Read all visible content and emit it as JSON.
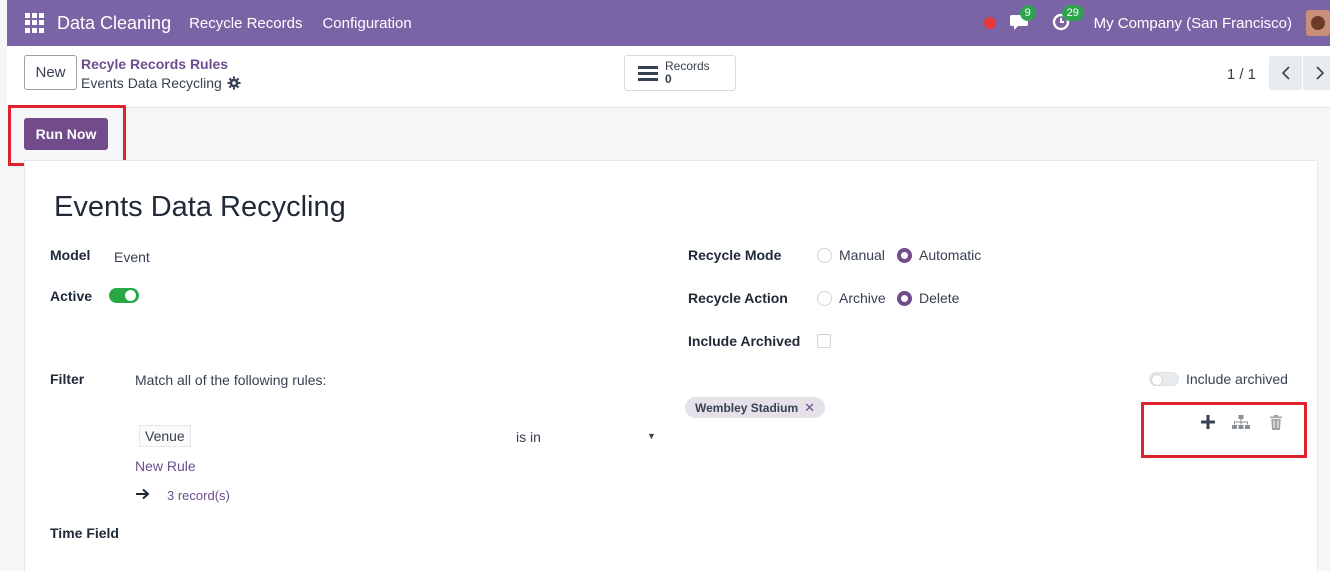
{
  "navbar": {
    "app_title": "Data Cleaning",
    "menu": [
      "Recycle Records",
      "Configuration"
    ],
    "messages_badge": "9",
    "activity_badge": "29",
    "company": "My Company (San Francisco)"
  },
  "control": {
    "new_label": "New",
    "breadcrumb_parent": "Recyle Records Rules",
    "breadcrumb_current": "Events Data Recycling",
    "stat_label": "Records",
    "stat_value": "0",
    "pager": "1 / 1"
  },
  "status": {
    "run_now_label": "Run Now"
  },
  "form": {
    "title": "Events Data Recycling",
    "model_label": "Model",
    "model_value": "Event",
    "active_label": "Active",
    "active": true,
    "recycle_mode_label": "Recycle Mode",
    "recycle_mode_options": [
      "Manual",
      "Automatic"
    ],
    "recycle_mode_selected": "Automatic",
    "recycle_action_label": "Recycle Action",
    "recycle_action_options": [
      "Archive",
      "Delete"
    ],
    "recycle_action_selected": "Delete",
    "include_archived_label": "Include Archived",
    "include_archived": false,
    "filter_label": "Filter",
    "filter_match_text": "Match all of the following rules:",
    "filter_include_archived_label": "Include archived",
    "rule_field": "Venue",
    "rule_operator": "is in",
    "rule_value_tag": "Wembley Stadium",
    "new_rule_label": "New Rule",
    "records_link": "3 record(s)",
    "time_field_label": "Time Field"
  },
  "colors": {
    "navbar": "#7a64a5",
    "primary": "#714b8a",
    "highlight": "#e0212e",
    "toggle_on": "#28a745"
  }
}
